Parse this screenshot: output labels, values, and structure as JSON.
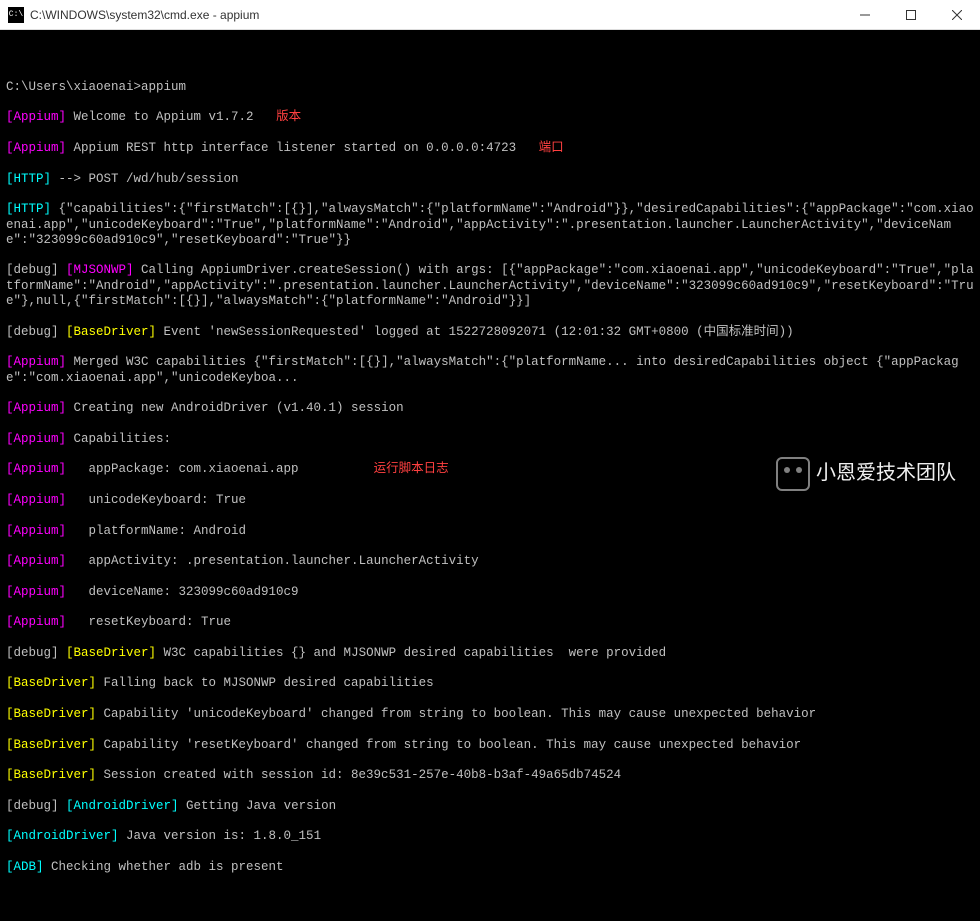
{
  "window": {
    "title": "C:\\WINDOWS\\system32\\cmd.exe - appium",
    "icon_label": "C:\\"
  },
  "annotations": {
    "version": "版本",
    "port": "端口",
    "log": "运行脚本日志"
  },
  "watermark": "小恩爱技术团队",
  "lines": {
    "empty": " ",
    "prompt": "C:\\Users\\xiaoenai>appium",
    "l01_tag": "[Appium]",
    "l01_txt": " Welcome to Appium v1.7.2",
    "l02_tag": "[Appium]",
    "l02_txt": " Appium REST http interface listener started on 0.0.0.0:4723",
    "l03_tag": "[HTTP]",
    "l03_txt": " --> POST /wd/hub/session",
    "l04_tag": "[HTTP]",
    "l04_txt": " {\"capabilities\":{\"firstMatch\":[{}],\"alwaysMatch\":{\"platformName\":\"Android\"}},\"desiredCapabilities\":{\"appPackage\":\"com.xiaoenai.app\",\"unicodeKeyboard\":\"True\",\"platformName\":\"Android\",\"appActivity\":\".presentation.launcher.LauncherActivity\",\"deviceName\":\"323099c60ad910c9\",\"resetKeyboard\":\"True\"}}",
    "l05_pre": "[debug] ",
    "l05_tag": "[MJSONWP]",
    "l05_txt": " Calling AppiumDriver.createSession() with args: [{\"appPackage\":\"com.xiaoenai.app\",\"unicodeKeyboard\":\"True\",\"platformName\":\"Android\",\"appActivity\":\".presentation.launcher.LauncherActivity\",\"deviceName\":\"323099c60ad910c9\",\"resetKeyboard\":\"True\"},null,{\"firstMatch\":[{}],\"alwaysMatch\":{\"platformName\":\"Android\"}}]",
    "l06_pre": "[debug] ",
    "l06_tag": "[BaseDriver]",
    "l06_txt": " Event 'newSessionRequested' logged at 1522728092071 (12:01:32 GMT+0800 (中国标准时间))",
    "l07_tag": "[Appium]",
    "l07_txt": " Merged W3C capabilities {\"firstMatch\":[{}],\"alwaysMatch\":{\"platformName... into desiredCapabilities object {\"appPackage\":\"com.xiaoenai.app\",\"unicodeKeyboa...",
    "l08_tag": "[Appium]",
    "l08_txt": " Creating new AndroidDriver (v1.40.1) session",
    "l09_tag": "[Appium]",
    "l09_txt": " Capabilities:",
    "l10_tag": "[Appium]",
    "l10_txt": "   appPackage: com.xiaoenai.app",
    "l11_tag": "[Appium]",
    "l11_txt": "   unicodeKeyboard: True",
    "l12_tag": "[Appium]",
    "l12_txt": "   platformName: Android",
    "l13_tag": "[Appium]",
    "l13_txt": "   appActivity: .presentation.launcher.LauncherActivity",
    "l14_tag": "[Appium]",
    "l14_txt": "   deviceName: 323099c60ad910c9",
    "l15_tag": "[Appium]",
    "l15_txt": "   resetKeyboard: True",
    "l16_pre": "[debug] ",
    "l16_tag": "[BaseDriver]",
    "l16_txt": " W3C capabilities {} and MJSONWP desired capabilities  were provided",
    "l17_tag": "[BaseDriver]",
    "l17_txt": " Falling back to MJSONWP desired capabilities",
    "l18_tag": "[BaseDriver]",
    "l18_txt": " Capability 'unicodeKeyboard' changed from string to boolean. This may cause unexpected behavior",
    "l19_tag": "[BaseDriver]",
    "l19_txt": " Capability 'resetKeyboard' changed from string to boolean. This may cause unexpected behavior",
    "l20_tag": "[BaseDriver]",
    "l20_txt": " Session created with session id: 8e39c531-257e-40b8-b3af-49a65db74524",
    "l21_pre": "[debug] ",
    "l21_tag": "[AndroidDriver]",
    "l21_txt": " Getting Java version",
    "l22_tag": "[AndroidDriver]",
    "l22_txt": " Java version is: 1.8.0_151",
    "l23_tag": "[ADB]",
    "l23_txt": " Checking whether adb is present"
  }
}
